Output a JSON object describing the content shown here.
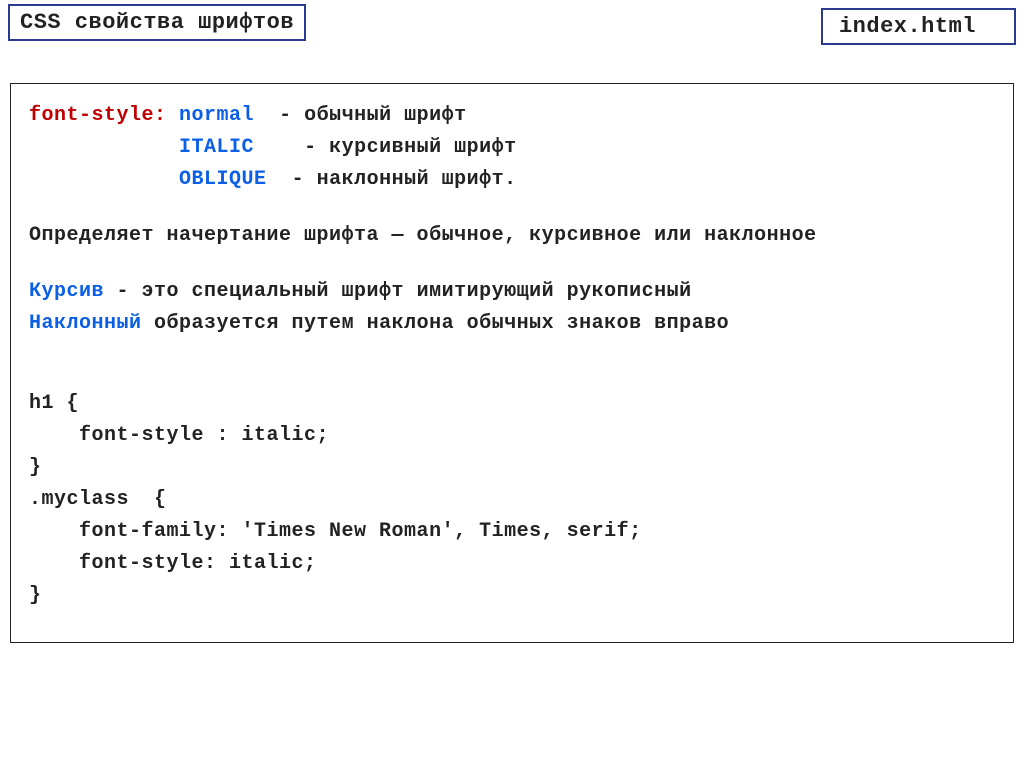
{
  "header": {
    "title": "CSS свойства шрифтов",
    "filename": "index.html"
  },
  "content": {
    "property_name": "font-style:",
    "values": {
      "normal": {
        "name": "normal",
        "desc": "- обычный шрифт"
      },
      "italic": {
        "name": "italic",
        "desc": "- курсивный шрифт"
      },
      "oblique": {
        "name": "oblique",
        "desc": "- наклонный шрифт."
      }
    },
    "definition": "Определяет начертание шрифта — обычное, курсивное или наклонное",
    "explain": {
      "kursiv_label": "Курсив",
      "kursiv_text": "  - это специальный шрифт имитирующий рукописный",
      "naklon_label": "Наклонный",
      "naklon_text": "  образуется путем наклона обычных знаков вправо"
    },
    "code": {
      "l1": "h1 {",
      "l2": "    font-style : italic;",
      "l3": "}",
      "l4": ".myclass  {",
      "l5": "    font-family: 'Times New Roman', Times, serif;",
      "l6": "    font-style: italic;",
      "l7": "}"
    }
  }
}
